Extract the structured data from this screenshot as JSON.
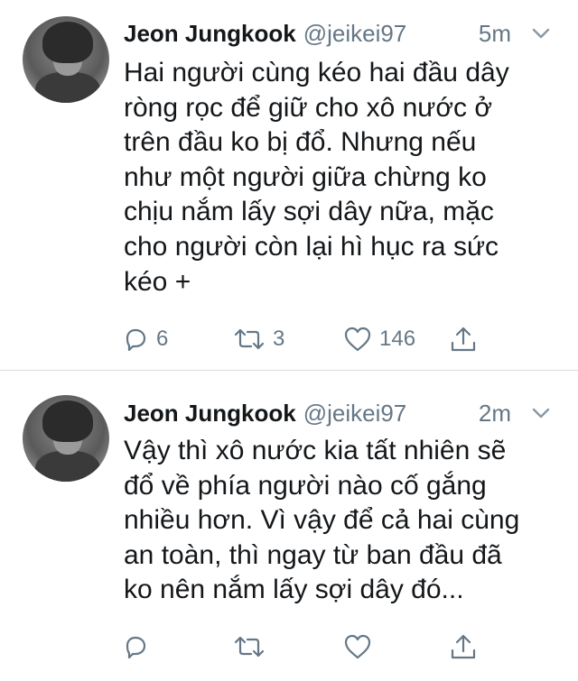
{
  "tweets": [
    {
      "name": "Jeon Jungkook",
      "handle": "@jeikei97",
      "time": "5m",
      "lines": [
        "Hai người cùng kéo hai đầu dây",
        "ròng rọc để giữ cho xô nước ở",
        "trên đầu ko bị đổ. Nhưng nếu",
        "như một người giữa chừng ko",
        "chịu nắm lấy sợi dây nữa, mặc",
        "cho người còn lại hì hục ra sức",
        "kéo +"
      ],
      "reply_count": "6",
      "retweet_count": "3",
      "like_count": "146"
    },
    {
      "name": "Jeon Jungkook",
      "handle": "@jeikei97",
      "time": "2m",
      "lines": [
        "Vậy thì xô nước kia tất nhiên sẽ",
        "đổ về phía người nào cố gắng",
        "nhiều hơn. Vì vậy để cả hai cùng",
        "an toàn, thì ngay từ ban đầu đã",
        "ko nên nắm lấy sợi dây đó..."
      ],
      "reply_count": "",
      "retweet_count": "",
      "like_count": ""
    }
  ],
  "icons": {
    "reply": "reply-icon",
    "retweet": "retweet-icon",
    "like": "heart-icon",
    "share": "share-icon",
    "menu": "chevron-down-icon"
  },
  "colors": {
    "text": "#14171a",
    "secondary": "#657786",
    "divider": "#d7dce0"
  }
}
